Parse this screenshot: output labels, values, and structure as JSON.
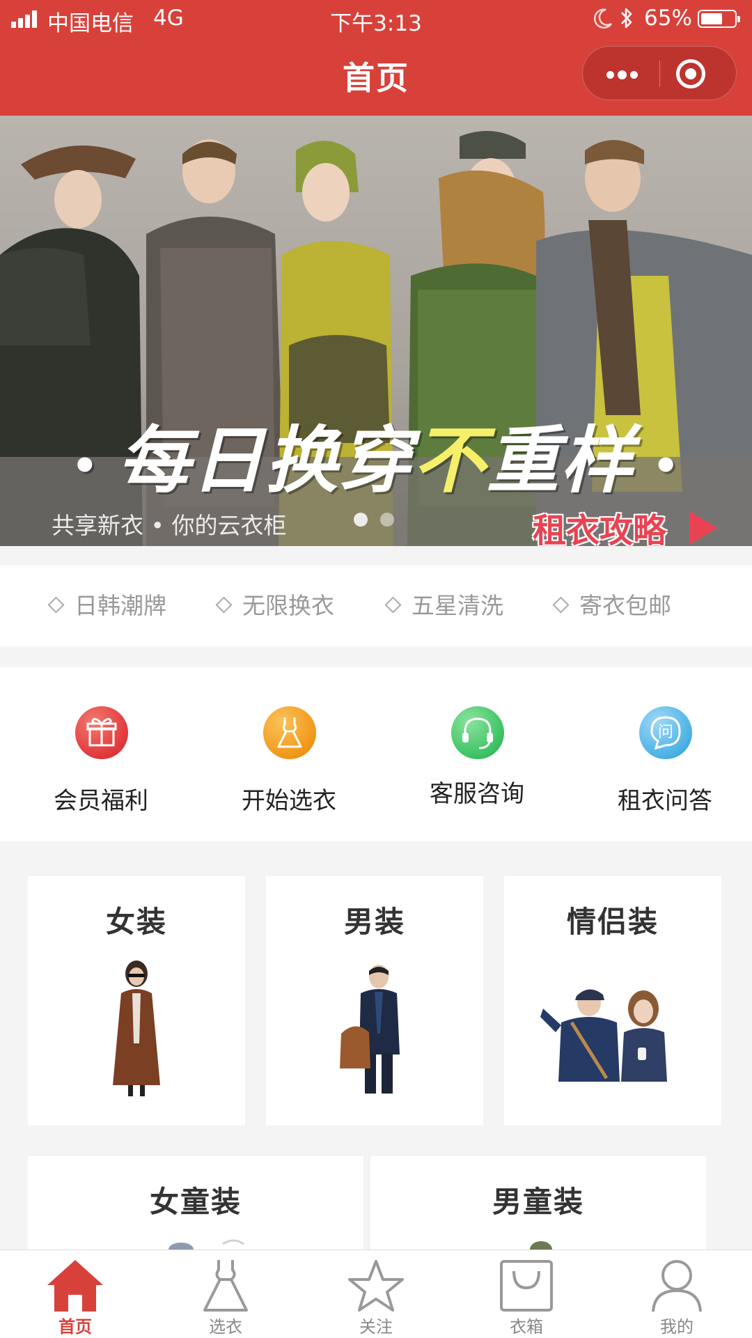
{
  "status_bar": {
    "carrier": "中国电信",
    "network": "4G",
    "time": "下午3:13",
    "battery": "65%",
    "battery_level": 0.65
  },
  "nav": {
    "title": "首页",
    "more_icon": "more-dots-icon",
    "close_icon": "target-close-icon"
  },
  "banner": {
    "headline_part1": "每日换穿",
    "headline_highlight": "不",
    "headline_part2": "重样",
    "subtitle": "共享新衣 • 你的云衣柜",
    "link_label": "租衣攻略",
    "slide_count": 2,
    "active_slide": 1
  },
  "features": [
    "日韩潮牌",
    "无限换衣",
    "五星清洗",
    "寄衣包邮"
  ],
  "quick_menu": [
    {
      "label": "会员福利",
      "icon": "gift-icon",
      "color": "#e33b3e"
    },
    {
      "label": "开始选衣",
      "icon": "dress-icon",
      "color": "#f29a1d"
    },
    {
      "label": "客服咨询",
      "icon": "headset-icon",
      "color": "#3fc466"
    },
    {
      "label": "租衣问答",
      "icon": "question-bubble-icon",
      "color": "#4fb4e6"
    }
  ],
  "categories": [
    {
      "title": "女装"
    },
    {
      "title": "男装"
    },
    {
      "title": "情侣装"
    },
    {
      "title": "女童装"
    },
    {
      "title": "男童装"
    }
  ],
  "tabs": [
    {
      "label": "首页",
      "icon": "home-icon",
      "active": true
    },
    {
      "label": "选衣",
      "icon": "dress-outline-icon",
      "active": false
    },
    {
      "label": "关注",
      "icon": "star-icon",
      "active": false
    },
    {
      "label": "衣箱",
      "icon": "bag-icon",
      "active": false
    },
    {
      "label": "我的",
      "icon": "user-icon",
      "active": false
    }
  ],
  "colors": {
    "primary": "#d8413a",
    "highlight": "#f5ef6a",
    "link": "#e94352"
  }
}
